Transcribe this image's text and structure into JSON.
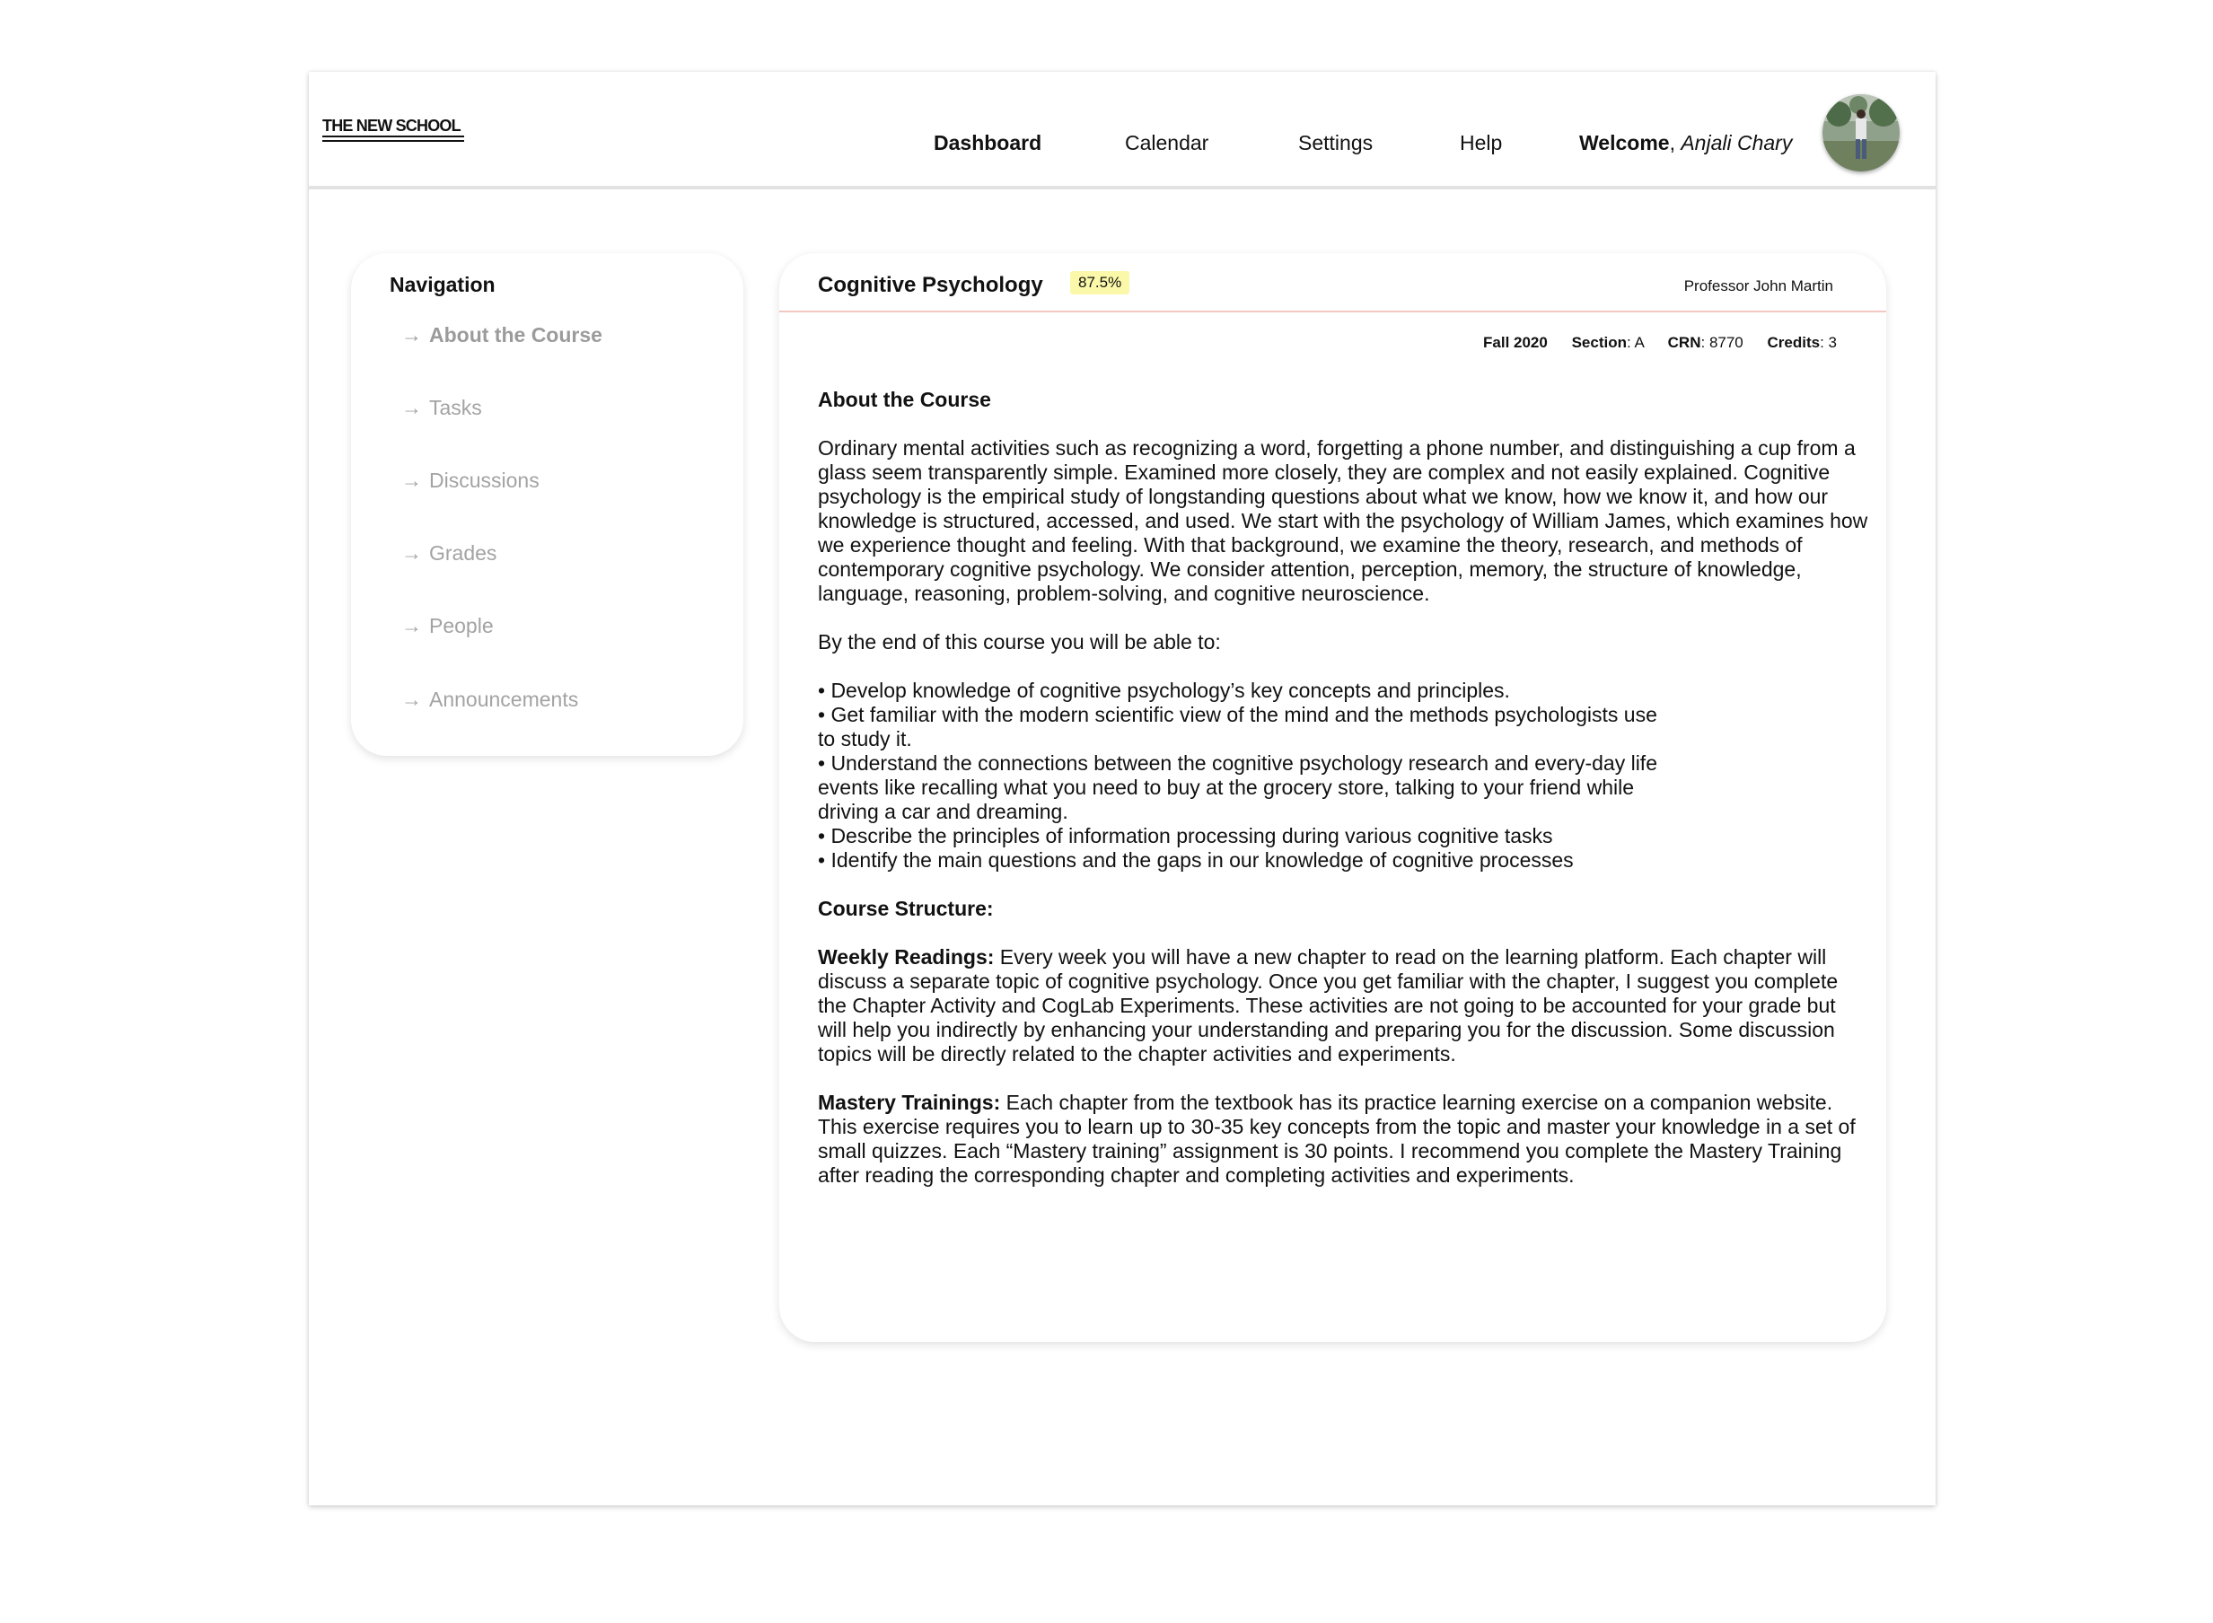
{
  "header": {
    "logo_text": "THE NEW SCHOOL",
    "nav": [
      "Dashboard",
      "Calendar",
      "Settings",
      "Help"
    ],
    "active_nav": "Dashboard",
    "welcome_label": "Welcome",
    "user_name": "Anjali Chary"
  },
  "sidebar": {
    "title": "Navigation",
    "items": [
      {
        "label": "About the Course",
        "active": true
      },
      {
        "label": "Tasks"
      },
      {
        "label": "Discussions"
      },
      {
        "label": "Grades"
      },
      {
        "label": "People"
      },
      {
        "label": "Announcements"
      }
    ]
  },
  "course": {
    "title": "Cognitive Psychology",
    "grade": "87.5%",
    "professor": "Professor John Martin",
    "term": "Fall 2020",
    "section_label": "Section",
    "section": "A",
    "crn_label": "CRN",
    "crn": "8770",
    "credits_label": "Credits",
    "credits": "3"
  },
  "about": {
    "heading": "About the Course",
    "intro": "Ordinary mental activities such as recognizing a word, forgetting a phone number, and distinguishing a cup from a glass seem transparently simple. Examined more closely, they are complex and not easily explained. Cognitive psychology is the empirical study of longstanding questions about what we know, how we know it, and how our knowledge is structured, accessed, and used. We start with the psychology of William James, which examines how we experience thought and feeling. With that background, we examine the theory, research, and methods of contemporary cognitive psychology. We consider attention, perception, memory, the structure of knowledge, language, reasoning, problem-solving, and cognitive neuroscience.",
    "outcomes_lead": "By the end of this course you will be able to:",
    "outcomes": [
      " • Develop knowledge of cognitive psychology’s key concepts and principles.",
      "• Get familiar with the modern scientific view of the mind and the methods psychologists use to study it.",
      "• Understand the connections between the cognitive psychology research and every-day life events like recalling what you need to buy at the grocery store, talking to your friend while driving a car and dreaming.",
      "• Describe the principles of information processing during various cognitive tasks",
      "• Identify the main questions and the gaps in our knowledge of cognitive processes"
    ],
    "structure_heading": "Course Structure:",
    "weekly_label": "Weekly Readings:",
    "weekly_text": " Every week you will have a new chapter to read on the learning platform. Each chapter will discuss a separate topic of cognitive psychology. Once you get familiar with the chapter, I suggest you complete the Chapter Activity and CogLab Experiments. These activities are not going to be accounted for your grade but will help you indirectly by enhancing your understanding and preparing you for the discussion. Some discussion topics will be directly related to the chapter activities and experiments.",
    "mastery_label": "Mastery Trainings:",
    "mastery_text": " Each chapter from the textbook has its practice learning exercise on a companion website. This exercise requires you to learn up to 30-35 key concepts from the topic and master your knowledge in a set of small quizzes. Each “Mastery training” assignment is 30 points. I recommend you complete the Mastery Training after reading the corresponding chapter and completing activities and experiments."
  },
  "colors": {
    "grade_badge_bg": "#fbf9a9",
    "header_divider": "#f3c8c2",
    "inactive_nav": "#a3a3a3"
  }
}
